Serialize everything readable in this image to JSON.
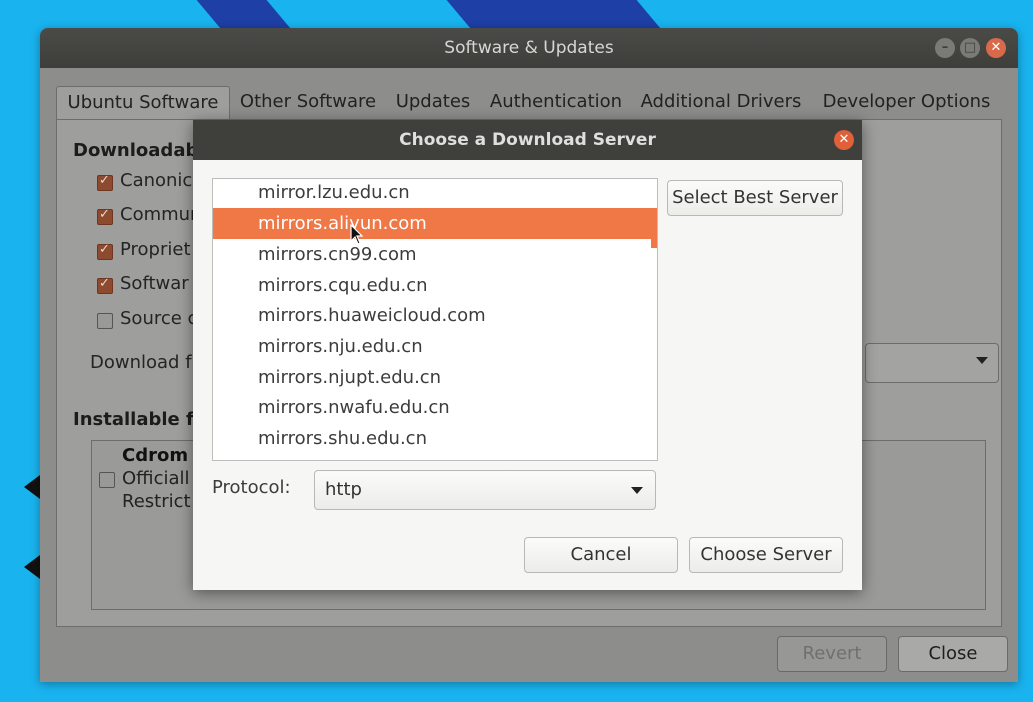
{
  "window": {
    "title": "Software & Updates",
    "tabs": [
      "Ubuntu Software",
      "Other Software",
      "Updates",
      "Authentication",
      "Additional Drivers",
      "Developer Options"
    ],
    "downloadable_heading": "Downloadab",
    "components": [
      {
        "label": "Canonica",
        "checked": true
      },
      {
        "label": "Commun",
        "checked": true
      },
      {
        "label": "Propriet",
        "checked": true
      },
      {
        "label": "Softwar",
        "checked": true
      },
      {
        "label": "Source c",
        "checked": false
      }
    ],
    "download_from_label": "Download f",
    "installable_heading": "Installable fr",
    "cdrom": {
      "title": "Cdrom w",
      "line1": "Officiall",
      "line2": "Restrict"
    },
    "revert_label": "Revert",
    "close_label": "Close"
  },
  "dialog": {
    "title": "Choose a Download Server",
    "servers": [
      "mirror.lzu.edu.cn",
      "mirrors.aliyun.com",
      "mirrors.cn99.com",
      "mirrors.cqu.edu.cn",
      "mirrors.huaweicloud.com",
      "mirrors.nju.edu.cn",
      "mirrors.njupt.edu.cn",
      "mirrors.nwafu.edu.cn",
      "mirrors.shu.edu.cn"
    ],
    "selected_server": "mirrors.aliyun.com",
    "select_best_label": "Select Best Server",
    "protocol_label": "Protocol:",
    "protocol_value": "http",
    "cancel_label": "Cancel",
    "choose_label": "Choose Server"
  },
  "colors": {
    "accent": "#f07746",
    "titlebar": "#3f3f3c",
    "desktop": "#19b4f0"
  },
  "icons": {
    "close": "close-icon",
    "minimize": "minimize-icon",
    "maximize": "maximize-icon",
    "dropdown": "chevron-down-icon",
    "cursor": "mouse-pointer-icon"
  }
}
